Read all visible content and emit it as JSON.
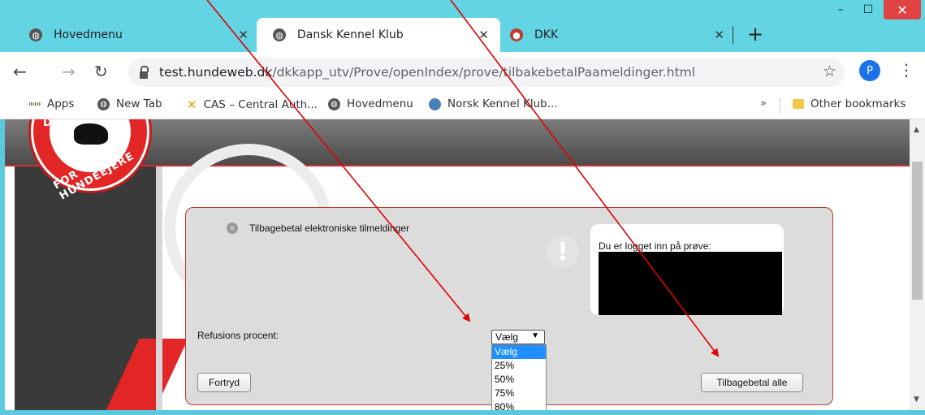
{
  "browser": {
    "tabs": [
      {
        "label": "Hovedmenu",
        "icon": "globe-icon"
      },
      {
        "label": "Dansk Kennel Klub",
        "icon": "globe-icon",
        "active": true
      },
      {
        "label": "DKK",
        "icon": "dkk-favicon-icon"
      }
    ],
    "new_tab_symbol": "+",
    "window": {
      "minimize": "–",
      "maximize": "☐",
      "close": "✕"
    },
    "url_host": "test.hundeweb.dk",
    "url_path": "/dkkapp_utv/Prove/openIndex/prove/tilbakebetalPaameldinger.html",
    "profile_initial": "P",
    "bookmarks": [
      {
        "label": "Apps",
        "icon": "apps-grid-icon"
      },
      {
        "label": "New Tab",
        "icon": "globe-icon"
      },
      {
        "label": "CAS – Central Auth...",
        "icon": "cas-icon"
      },
      {
        "label": "Hovedmenu",
        "icon": "globe-icon"
      },
      {
        "label": "Norsk Kennel Klub...",
        "icon": "nkk-icon"
      }
    ],
    "bookmarks_overflow": "»",
    "other_bookmarks": "Other bookmarks"
  },
  "logo": {
    "text_top": "DA",
    "text_bottom": "FOR HUNDEEJERE"
  },
  "panel": {
    "title": "Tilbagebetal elektroniske tilmeldinger",
    "login_label": "Du er logget inn på prøve:",
    "refund_label": "Refusions procent:",
    "select_value": "Vælg",
    "options": [
      "Vælg",
      "25%",
      "50%",
      "75%",
      "80%"
    ],
    "selected_option": "Vælg",
    "cancel_button": "Fortryd",
    "refund_all_button": "Tilbagebetal alle"
  },
  "colors": {
    "tab_strip": "#62d4e3",
    "accent_red": "#d52b2b",
    "dropdown_highlight": "#1e90ff",
    "annotation_arrow": "#e00000"
  }
}
